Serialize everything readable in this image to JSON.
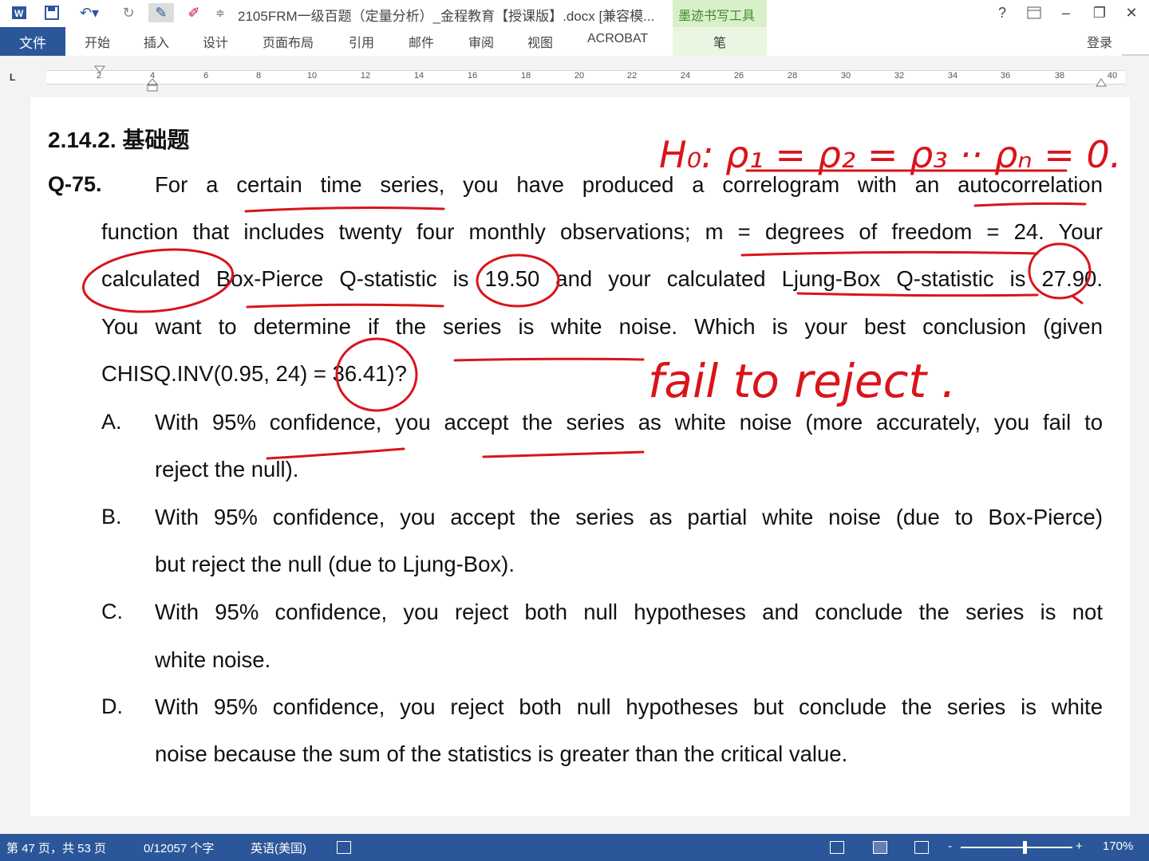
{
  "titlebar": {
    "doc_title": "2105FRM一级百题（定量分析）_金程教育【授课版】.docx [兼容模...",
    "ink_tools": "墨迹书写工具",
    "help": "?",
    "minimize": "–",
    "restore": "❐",
    "close": "✕"
  },
  "ribbon": {
    "file": "文件",
    "tabs": [
      "开始",
      "插入",
      "设计",
      "页面布局",
      "引用",
      "邮件",
      "审阅",
      "视图",
      "ACROBAT"
    ],
    "pen": "笔",
    "login": "登录"
  },
  "ruler": {
    "corner": "L",
    "ticks": [
      "2",
      "4",
      "6",
      "8",
      "10",
      "12",
      "14",
      "16",
      "18",
      "20",
      "22",
      "24",
      "26",
      "28",
      "30",
      "32",
      "34",
      "36",
      "38",
      "40"
    ]
  },
  "document": {
    "heading": "2.14.2.  基础题",
    "question_label": "Q-75.",
    "lines": [
      "For a certain time series, you have produced a correlogram with an autocorrelation",
      "function that includes twenty four monthly observations; m = degrees of freedom = 24. Your",
      "calculated Box-Pierce Q-statistic is 19.50 and your calculated Ljung-Box Q-statistic is 27.90.",
      "You want to determine if the series is white noise. Which is your best conclusion (given",
      "CHISQ.INV(0.95, 24) = 36.41)?"
    ],
    "options": [
      {
        "letter": "A.",
        "lines": [
          "With 95% confidence, you accept the series as white noise (more accurately, you fail to",
          "reject the null)."
        ]
      },
      {
        "letter": "B.",
        "lines": [
          "With 95% confidence, you accept the series as partial white noise (due to Box-Pierce)",
          "but reject the null (due to Ljung-Box)."
        ]
      },
      {
        "letter": "C.",
        "lines": [
          "With 95% confidence, you reject both null hypotheses and conclude the series is not",
          "white noise."
        ]
      },
      {
        "letter": "D.",
        "lines": [
          "With 95% confidence, you reject both null hypotheses but conclude the series is white",
          "noise because the sum of the statistics is greater than the critical value."
        ]
      }
    ]
  },
  "annotations": {
    "hypothesis": "H₀: ρ₁ = ρ₂ = ρ₃ ·· ρₙ = 0.",
    "conclusion": "fail to reject .",
    "ink_color": "#d9141b"
  },
  "statusbar": {
    "page": "第 47 页，共 53 页",
    "words": "0/12057 个字",
    "language": "英语(美国)",
    "zoom_minus": "-",
    "zoom_plus": "+",
    "zoom": "170%"
  }
}
